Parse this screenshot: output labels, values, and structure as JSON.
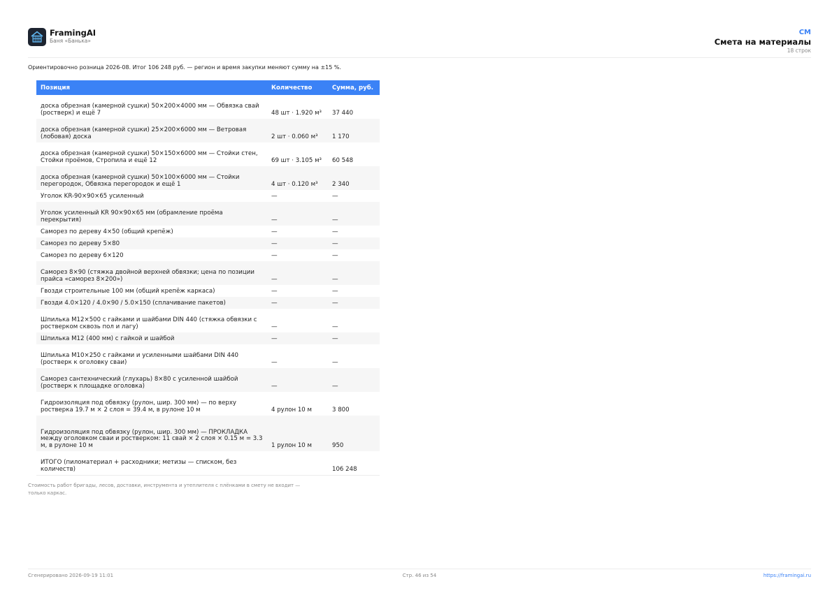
{
  "header": {
    "brand": "FramingAI",
    "project": "Баня «Банька»",
    "code": "СМ",
    "title": "Смета на материалы",
    "rows_count": "18 строк"
  },
  "intro": "Ориентировочно розница 2026-08. Итог 106 248 руб. — регион и время закупки меняют сумму на ±15 %.",
  "table": {
    "columns": [
      "Позиция",
      "Количество",
      "Сумма, руб."
    ],
    "rows": [
      {
        "position": "доска обрезная (камерной сушки) 50×200×4000 мм — Обвязка свай (ростверк) и ещё 7",
        "qty": "48 шт · 1.920 м³",
        "sum": "37 440"
      },
      {
        "position": "доска обрезная (камерной сушки) 25×200×6000 мм — Ветровая (лобовая) доска",
        "qty": "2 шт · 0.060 м³",
        "sum": "1 170"
      },
      {
        "position": "доска обрезная (камерной сушки) 50×150×6000 мм — Стойки стен, Стойки проёмов, Стропила и ещё 12",
        "qty": "69 шт · 3.105 м³",
        "sum": "60 548"
      },
      {
        "position": "доска обрезная (камерной сушки) 50×100×6000 мм — Стойки перегородок, Обвязка перегородок и ещё 1",
        "qty": "4 шт · 0.120 м³",
        "sum": "2 340"
      },
      {
        "position": "Уголок KR-90×90×65 усиленный",
        "qty": "—",
        "sum": "—"
      },
      {
        "position": "Уголок усиленный KR 90×90×65 мм (обрамление проёма перекрытия)",
        "qty": "—",
        "sum": "—"
      },
      {
        "position": "Саморез по дереву 4×50 (общий крепёж)",
        "qty": "—",
        "sum": "—"
      },
      {
        "position": "Саморез по дереву 5×80",
        "qty": "—",
        "sum": "—"
      },
      {
        "position": "Саморез по дереву 6×120",
        "qty": "—",
        "sum": "—"
      },
      {
        "position": "Саморез 8×90 (стяжка двойной верхней обвязки; цена по позиции прайса «саморез 8×200»)",
        "qty": "—",
        "sum": "—"
      },
      {
        "position": "Гвозди строительные 100 мм (общий крепёж каркаса)",
        "qty": "—",
        "sum": "—"
      },
      {
        "position": "Гвозди 4.0×120 / 4.0×90 / 5.0×150 (сплачивание пакетов)",
        "qty": "—",
        "sum": "—"
      },
      {
        "position": "Шпилька М12×500 с гайками и шайбами DIN 440 (стяжка обвязки с ростверком сквозь пол и лагу)",
        "qty": "—",
        "sum": "—"
      },
      {
        "position": "Шпилька М12 (400 мм) с гайкой и шайбой",
        "qty": "—",
        "sum": "—"
      },
      {
        "position": "Шпилька М10×250 с гайками и усиленными шайбами DIN 440 (ростверк к оголовку сваи)",
        "qty": "—",
        "sum": "—"
      },
      {
        "position": "Саморез сантехнический (глухарь) 8×80 с усиленной шайбой (ростверк к площадке оголовка)",
        "qty": "—",
        "sum": "—"
      },
      {
        "position": "Гидроизоляция под обвязку (рулон, шир. 300 мм) — по верху ростверка 19.7 м × 2 слоя = 39.4 м, в рулоне 10 м",
        "qty": "4 рулон 10 м",
        "sum": "3 800"
      },
      {
        "position": "Гидроизоляция под обвязку (рулон, шир. 300 мм) — ПРОКЛАДКА между оголовком сваи и ростверком: 11 свай × 2 слоя × 0.15 м = 3.3 м, в рулоне 10 м",
        "qty": "1 рулон 10 м",
        "sum": "950"
      }
    ],
    "total": {
      "position": "ИТОГО (пиломатериал + расходники; метизы — списком, без количеств)",
      "qty": "",
      "sum": "106 248"
    }
  },
  "note": "Стоимость работ бригады, лесов, доставки, инструмента и утеплителя с плёнками в смету не входит — только каркас.",
  "footer": {
    "generated": "Сгенерировано 2026-09-19 11:01",
    "page": "Стр. 46 из 54",
    "url": "https://framingai.ru"
  },
  "colors": {
    "accent": "#3b82f6",
    "logo_bg": "#1d2430"
  }
}
